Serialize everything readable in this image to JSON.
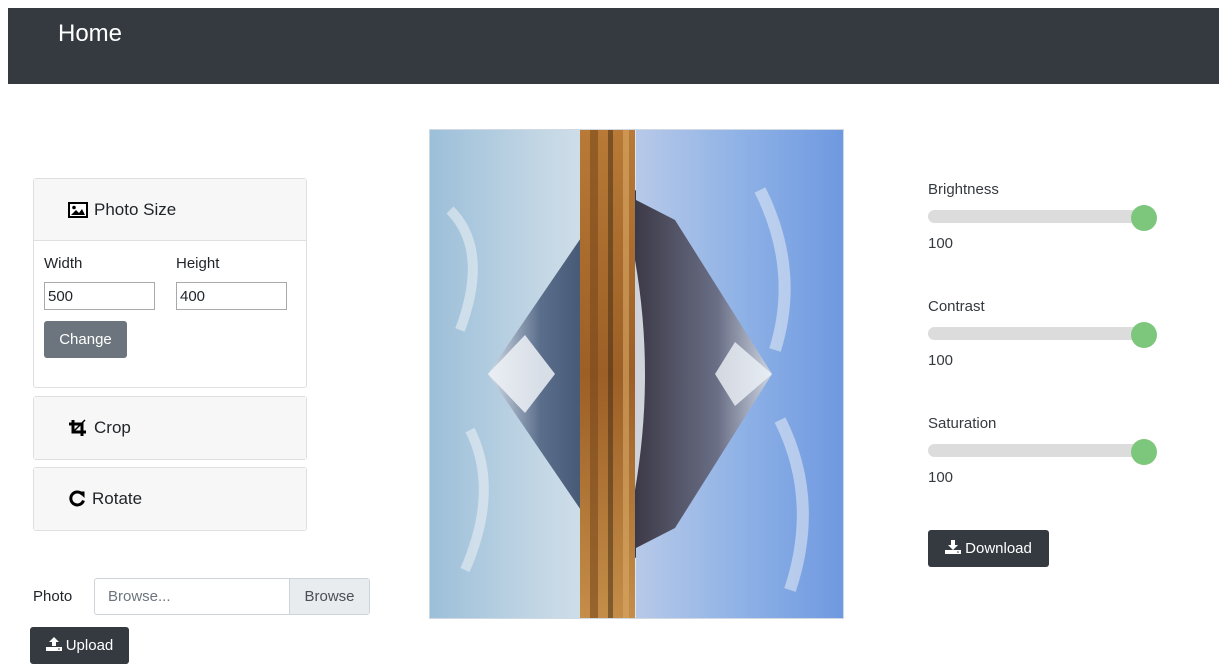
{
  "nav": {
    "brand": "Home"
  },
  "photo_size": {
    "title": "Photo Size",
    "width_label": "Width",
    "height_label": "Height",
    "width_value": "500",
    "height_value": "400",
    "change_label": "Change"
  },
  "crop": {
    "title": "Crop"
  },
  "rotate": {
    "title": "Rotate"
  },
  "upload": {
    "photo_label": "Photo",
    "file_placeholder": "Browse...",
    "browse_label": "Browse",
    "upload_label": "Upload"
  },
  "sliders": {
    "brightness": {
      "label": "Brightness",
      "value": "100",
      "level": 1.0
    },
    "contrast": {
      "label": "Contrast",
      "value": "100",
      "level": 1.0
    },
    "saturation": {
      "label": "Saturation",
      "value": "100",
      "level": 1.0
    }
  },
  "download": {
    "label": "Download"
  },
  "colors": {
    "navbar": "#343a40",
    "slider_thumb": "#7dc77d",
    "change_button": "#6c757d"
  },
  "icons": {
    "photo_size": "image-icon",
    "crop": "crop-icon",
    "rotate": "rotate-icon",
    "upload": "upload-icon",
    "download": "download-icon"
  }
}
